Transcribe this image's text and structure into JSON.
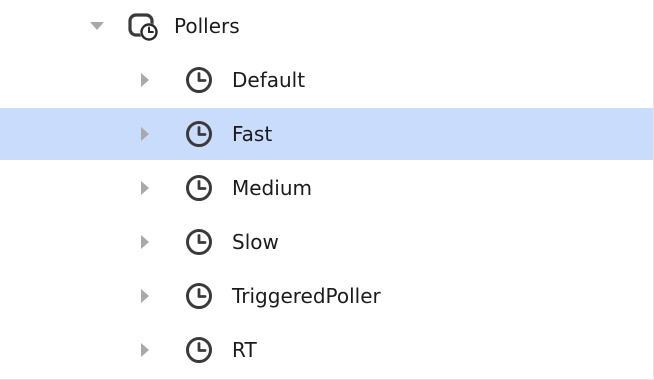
{
  "tree": {
    "root": {
      "label": "Pollers",
      "icon": "poller-folder-icon",
      "expanded": true
    },
    "children": [
      {
        "label": "Default",
        "icon": "clock-icon",
        "expanded": false,
        "selected": false
      },
      {
        "label": "Fast",
        "icon": "clock-icon",
        "expanded": false,
        "selected": true
      },
      {
        "label": "Medium",
        "icon": "clock-icon",
        "expanded": false,
        "selected": false
      },
      {
        "label": "Slow",
        "icon": "clock-icon",
        "expanded": false,
        "selected": false
      },
      {
        "label": "TriggeredPoller",
        "icon": "clock-icon",
        "expanded": false,
        "selected": false
      },
      {
        "label": "RT",
        "icon": "clock-icon",
        "expanded": false,
        "selected": false
      }
    ]
  },
  "colors": {
    "selection": "#c9dcfb",
    "arrow": "#a9a9a9",
    "icon_stroke": "#3a3a3a"
  }
}
